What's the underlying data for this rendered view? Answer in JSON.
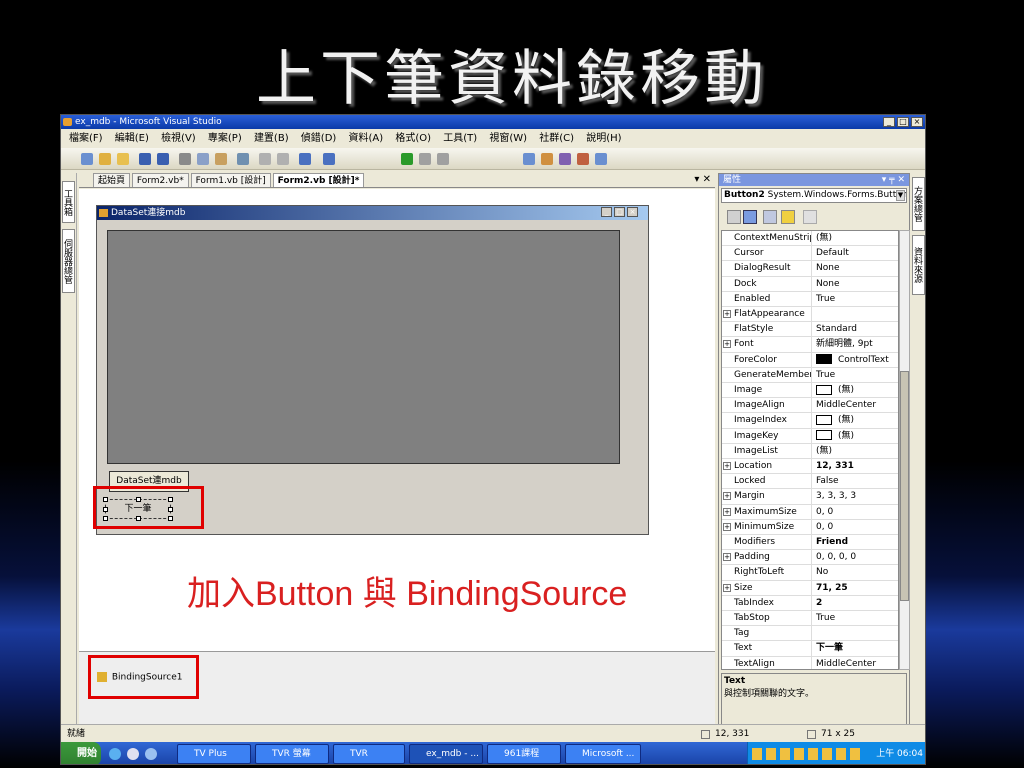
{
  "slide_title": "上下筆資料錄移動",
  "annotation": "加入Button 與 BindingSource",
  "window": {
    "title": "ex_mdb - Microsoft Visual Studio",
    "controls": [
      "_",
      "□",
      "×"
    ]
  },
  "menu": [
    "檔案(F)",
    "編輯(E)",
    "檢視(V)",
    "專案(P)",
    "建置(B)",
    "偵錯(D)",
    "資料(A)",
    "格式(O)",
    "工具(T)",
    "視窗(W)",
    "社群(C)",
    "說明(H)"
  ],
  "left_tabs": [
    "工具箱",
    "伺服器總管"
  ],
  "doc_tabs": [
    "起始頁",
    "Form2.vb*",
    "Form1.vb [設計]",
    "Form2.vb [設計]*"
  ],
  "doc_tab_controls": "▾ ✕",
  "form": {
    "title": "DataSet連接mdb",
    "button1": "DataSet連mdb",
    "button2": "下一筆"
  },
  "tray": {
    "component": "BindingSource1"
  },
  "properties": {
    "title": "屬性",
    "pin": "▾ ╤ ✕",
    "object": "Button2",
    "object_type": "System.Windows.Forms.Button",
    "rows": [
      {
        "name": "ContextMenuStrip",
        "value": "(無)",
        "expand": false
      },
      {
        "name": "Cursor",
        "value": "Default",
        "expand": false
      },
      {
        "name": "DialogResult",
        "value": "None",
        "expand": false
      },
      {
        "name": "Dock",
        "value": "None",
        "expand": false
      },
      {
        "name": "Enabled",
        "value": "True",
        "expand": false
      },
      {
        "name": "FlatAppearance",
        "value": "",
        "expand": true
      },
      {
        "name": "FlatStyle",
        "value": "Standard",
        "expand": false
      },
      {
        "name": "Font",
        "value": "新細明體, 9pt",
        "expand": true
      },
      {
        "name": "ForeColor",
        "value": "ControlText",
        "expand": false,
        "swatch": "#000000"
      },
      {
        "name": "GenerateMember",
        "value": "True",
        "expand": false
      },
      {
        "name": "Image",
        "value": "(無)",
        "expand": false,
        "swatch": "#ffffff"
      },
      {
        "name": "ImageAlign",
        "value": "MiddleCenter",
        "expand": false
      },
      {
        "name": "ImageIndex",
        "value": "(無)",
        "expand": false,
        "swatch": "#ffffff"
      },
      {
        "name": "ImageKey",
        "value": "(無)",
        "expand": false,
        "swatch": "#ffffff"
      },
      {
        "name": "ImageList",
        "value": "(無)",
        "expand": false
      },
      {
        "name": "Location",
        "value": "12, 331",
        "expand": true,
        "bold": true
      },
      {
        "name": "Locked",
        "value": "False",
        "expand": false
      },
      {
        "name": "Margin",
        "value": "3, 3, 3, 3",
        "expand": true
      },
      {
        "name": "MaximumSize",
        "value": "0, 0",
        "expand": true
      },
      {
        "name": "MinimumSize",
        "value": "0, 0",
        "expand": true
      },
      {
        "name": "Modifiers",
        "value": "Friend",
        "expand": false,
        "bold": true
      },
      {
        "name": "Padding",
        "value": "0, 0, 0, 0",
        "expand": true
      },
      {
        "name": "RightToLeft",
        "value": "No",
        "expand": false
      },
      {
        "name": "Size",
        "value": "71, 25",
        "expand": true,
        "bold": true
      },
      {
        "name": "TabIndex",
        "value": "2",
        "expand": false,
        "bold": true
      },
      {
        "name": "TabStop",
        "value": "True",
        "expand": false
      },
      {
        "name": "Tag",
        "value": "",
        "expand": false
      },
      {
        "name": "Text",
        "value": "下一筆",
        "expand": false,
        "bold": true
      },
      {
        "name": "TextAlign",
        "value": "MiddleCenter",
        "expand": false
      }
    ],
    "desc_title": "Text",
    "desc_text": "與控制項關聯的文字。"
  },
  "right_tabs": [
    "方案總管",
    "資料來源"
  ],
  "status": {
    "left": "就緒",
    "position": "12, 331",
    "size": "71 x 25"
  },
  "taskbar": {
    "start": "開始",
    "tasks": [
      "TV Plus",
      "TVR 螢幕",
      "TVR",
      "ex_mdb - ...",
      "961課程",
      "Microsoft ..."
    ],
    "clock": "上午 06:04"
  }
}
